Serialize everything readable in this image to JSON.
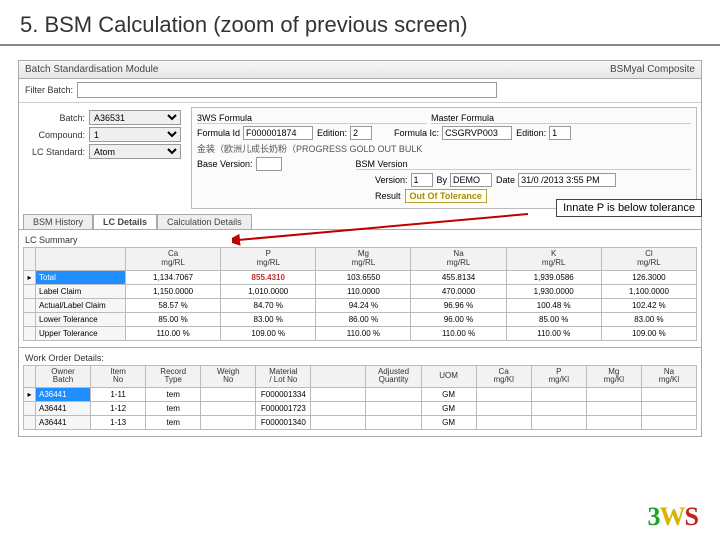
{
  "slide": {
    "title": "5. BSM Calculation (zoom of previous screen)"
  },
  "titlebar": {
    "app": "Batch Standardisation Module",
    "right": "BSMyal Composite"
  },
  "filter": {
    "label": "Filter Batch:"
  },
  "left": {
    "batch_lbl": "Batch:",
    "batch_val": "A36531",
    "compound_lbl": "Compound:",
    "compound_val": "1",
    "comp_count_lbl": "LC Standard:",
    "comp_count_val": "Atom"
  },
  "panel": {
    "head_left": "3WS Formula",
    "head_right": "Master Formula",
    "formula_id_lbl": "Formula Id",
    "formula_id_val": "F000001874",
    "edition_lbl": "Edition:",
    "edition_val": "2",
    "formula_ic_lbl": "Formula Ic:",
    "formula_ic_val": "CSGRVP003",
    "edition2_lbl": "Edition:",
    "edition2_val": "1",
    "desc": "金装（欧洲儿成长奶粉（PROGRESS GOLD OUT BULK",
    "base_lbl": "Base Version:",
    "base_val": "",
    "bsm_lbl": "BSM Version",
    "version_lbl": "Version:",
    "version_val": "1",
    "by_lbl": "By",
    "by_val": "DEMO",
    "date_lbl": "Date",
    "date_val": "31/0 /2013 3:55 PM",
    "result_lbl": "Result",
    "result_val": "Out Of Tolerance"
  },
  "tabs": {
    "t1": "BSM History",
    "t2": "LC Details",
    "t3": "Calculation Details"
  },
  "annotation": "Innate P is below tolerance",
  "lc": {
    "header": "LC Summary",
    "cols": [
      "",
      "",
      "Ca\nmg/RL",
      "P\nmg/RL",
      "Mg\nmg/RL",
      "Na\nmg/RL",
      "K\nmg/RL",
      "Cl\nmg/RL"
    ],
    "rows": [
      {
        "hdr": "Total",
        "v": [
          "1,134.7067",
          "855.4310",
          "103.6550",
          "455.8134",
          "1,939.0586",
          "126.3000"
        ]
      },
      {
        "hdr": "Label Claim",
        "v": [
          "1,150.0000",
          "1,010.0000",
          "110.0000",
          "470.0000",
          "1,930.0000",
          "1,100.0000"
        ]
      },
      {
        "hdr": "Actual/Label Claim",
        "v": [
          "58.57 %",
          "84.70 %",
          "94.24 %",
          "96.96 %",
          "100.48 %",
          "102.42 %"
        ]
      },
      {
        "hdr": "Lower Tolerance",
        "v": [
          "85.00 %",
          "83.00 %",
          "86.00 %",
          "96.00 %",
          "85.00 %",
          "83.00 %"
        ]
      },
      {
        "hdr": "Upper Tolerance",
        "v": [
          "110.00 %",
          "109.00 %",
          "110.00 %",
          "110.00 %",
          "110.00 %",
          "109.00 %"
        ]
      }
    ]
  },
  "wo": {
    "header": "Work Order Details:",
    "cols": [
      "",
      "Owner\nBatch",
      "Item\nNo",
      "Record\nType",
      "Weigh\nNo",
      "Material\n/ Lot No",
      "",
      "Adjusted\nQuantity",
      "UOM",
      "Ca\nmg/Kl",
      "P\nmg/Kl",
      "Mg\nmg/Kl",
      "Na\nmg/Kl"
    ],
    "rows": [
      {
        "v": [
          "A36441",
          "1-11",
          "tem",
          "",
          "F000001334",
          "",
          "",
          "GM",
          "",
          "",
          "",
          ""
        ]
      },
      {
        "v": [
          "A36441",
          "1-12",
          "tem",
          "",
          "F000001723",
          "",
          "",
          "GM",
          "",
          "",
          "",
          ""
        ]
      },
      {
        "v": [
          "A36441",
          "1-13",
          "tem",
          "",
          "F000001340",
          "",
          "",
          "GM",
          "",
          "",
          "",
          ""
        ]
      }
    ]
  },
  "logo": {
    "a": "3",
    "b": "W",
    "c": "S"
  }
}
